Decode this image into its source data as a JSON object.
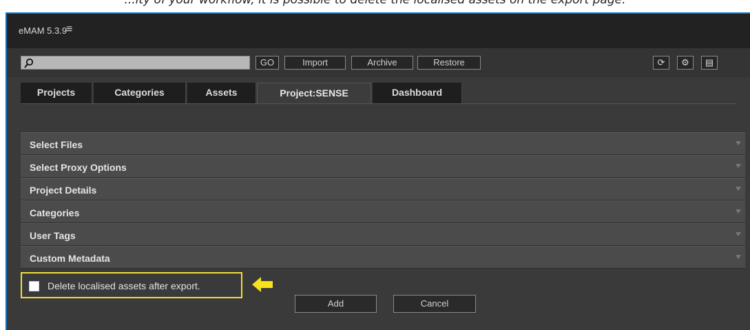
{
  "page_caption_fragment": "...ity of your workflow, it is possible to delete the localised assets on the export page.",
  "window": {
    "title": "eMAM 5.3.9",
    "menu_glyph": "≡"
  },
  "toolbar": {
    "search": {
      "value": "",
      "placeholder": ""
    },
    "buttons": [
      "GO",
      "Import",
      "Archive",
      "Restore"
    ],
    "icons": [
      "refresh-icon",
      "gear-icon",
      "document-icon"
    ],
    "icon_glyphs": [
      "⟳",
      "⚙",
      "▤"
    ]
  },
  "tabs": [
    {
      "label": "Projects",
      "active": false
    },
    {
      "label": "Categories",
      "active": false
    },
    {
      "label": "Assets",
      "active": false
    },
    {
      "label": "Project:SENSE",
      "active": true
    },
    {
      "label": "Dashboard",
      "active": false
    }
  ],
  "sections": [
    "Select Files",
    "Select Proxy Options",
    "Project Details",
    "Categories",
    "User Tags",
    "Custom Metadata"
  ],
  "options": {
    "delete_localised_label": "Delete localised assets after export.",
    "delete_localised_checked": false
  },
  "actions": {
    "add": "Add",
    "cancel": "Cancel"
  },
  "colors": {
    "highlight": "#f3df3a",
    "pointer": "#f7e21c",
    "frame": "#0a73c4"
  }
}
